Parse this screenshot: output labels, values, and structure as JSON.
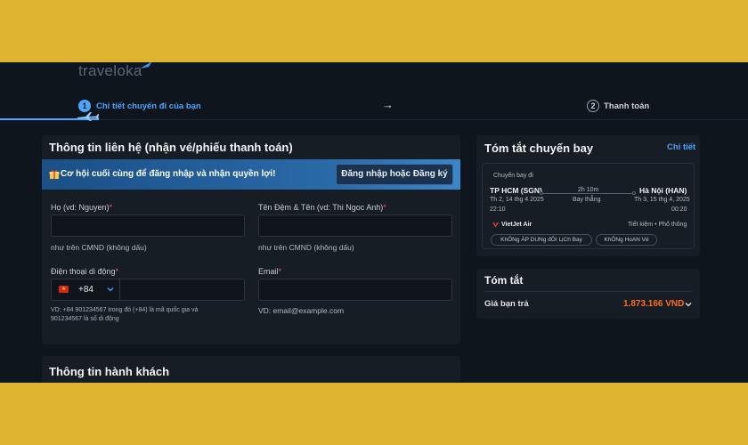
{
  "brand": {
    "name": "traveloka"
  },
  "stepper": {
    "step1": {
      "number": "1",
      "label": "Chi tiết chuyến đi của bạn"
    },
    "arrow": "→",
    "step2": {
      "number": "2",
      "label": "Thanh toán"
    }
  },
  "contact": {
    "title": "Thông tin liên hệ (nhận vé/phiếu thanh toán)",
    "banner": {
      "text": "Cơ hội cuối cùng để đăng nhập và nhận quyền lợi!",
      "button": "Đăng nhập hoặc Đăng ký"
    },
    "last_name": {
      "label": "Họ (vd: Nguyen)",
      "value": "",
      "hint": "như trên CMND (không dấu)"
    },
    "first_name": {
      "label": "Tên Đệm & Tên (vd: Thi Ngoc Anh)",
      "value": "",
      "hint": "như trên CMND (không dấu)"
    },
    "phone": {
      "label": "Điện thoại di động",
      "country_code": "+84",
      "value": "",
      "hint": "VD: +84 901234567 trong đó (+84) là mã quốc gia và 901234567 là số di động"
    },
    "email": {
      "label": "Email",
      "value": "",
      "hint": "VD: email@example.com"
    },
    "required_mark": "*"
  },
  "passenger": {
    "title": "Thông tin hành khách"
  },
  "flight_summary": {
    "title": "Tóm tắt chuyến bay",
    "detail_link": "Chi tiết",
    "leg_label": "Chuyến bay đi",
    "origin": {
      "city": "TP HCM (SGN)",
      "date": "Th 2, 14 thg 4 2025",
      "time": "22:10"
    },
    "destination": {
      "city": "Hà Nội (HAN)",
      "date": "Th 3, 15 thg 4, 2025",
      "time": "00:20"
    },
    "duration": "2h 10m",
    "stops": "Bay thẳng",
    "airline": "VietJet Air",
    "cabin": "Tiết kiệm • Phổ thông",
    "tags": [
      "KhÔNg ÁP DUNg đÔI LịCh Bay",
      "KhÔNg HoAN Vé"
    ]
  },
  "summary": {
    "title": "Tóm tắt",
    "price_label": "Giá bạn trả",
    "price": "1.873.166 VND"
  },
  "colors": {
    "accent": "#4aa6ff",
    "price": "#ff6b1a",
    "background": "#0f151d",
    "card": "#171d25",
    "frame": "#dcb42f"
  }
}
